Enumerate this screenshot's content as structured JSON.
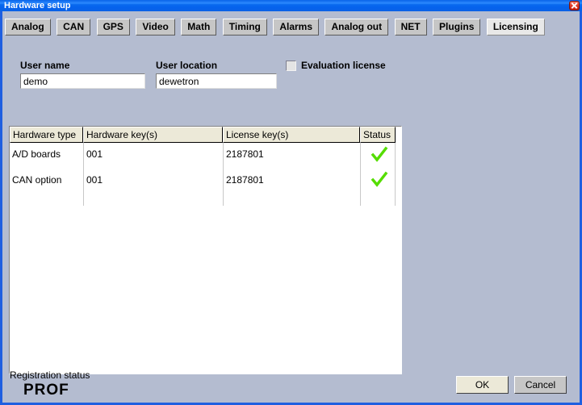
{
  "window": {
    "title": "Hardware setup",
    "close_icon": "close-icon",
    "accent_color": "#0a64e8",
    "client_color": "#b4bcd0"
  },
  "tabs": [
    {
      "label": "Analog",
      "active": false
    },
    {
      "label": "CAN",
      "active": false
    },
    {
      "label": "GPS",
      "active": false
    },
    {
      "label": "Video",
      "active": false
    },
    {
      "label": "Math",
      "active": false
    },
    {
      "label": "Timing",
      "active": false
    },
    {
      "label": "Alarms",
      "active": false
    },
    {
      "label": "Analog out",
      "active": false
    },
    {
      "label": "NET",
      "active": false
    },
    {
      "label": "Plugins",
      "active": false
    },
    {
      "label": "Licensing",
      "active": true
    }
  ],
  "form": {
    "user_name_label": "User name",
    "user_name_value": "demo",
    "user_location_label": "User location",
    "user_location_value": "dewetron",
    "evaluation_label": "Evaluation license",
    "evaluation_checked": false
  },
  "table": {
    "columns": [
      "Hardware type",
      "Hardware key(s)",
      "License key(s)",
      "Status"
    ],
    "rows": [
      {
        "hardware_type": "A/D boards",
        "hardware_key": "001",
        "license_key": "2187801",
        "status": "ok"
      },
      {
        "hardware_type": "CAN option",
        "hardware_key": "001",
        "license_key": "2187801",
        "status": "ok"
      }
    ],
    "status_ok_color": "#55dd00"
  },
  "registration": {
    "label": "Registration status",
    "value": "PROF"
  },
  "buttons": {
    "ok": "OK",
    "cancel": "Cancel"
  }
}
